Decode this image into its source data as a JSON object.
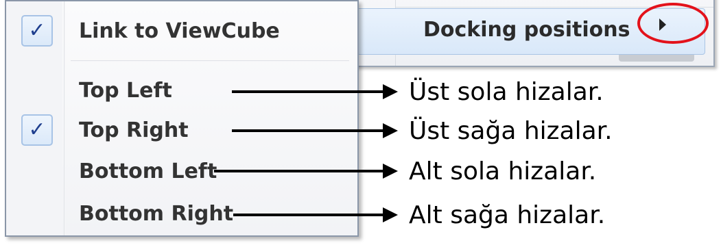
{
  "parent_menu": {
    "item_label": "Docking positions",
    "submenu_arrow_icon": "triangle-right-icon",
    "highlight_color": "#e3121b"
  },
  "submenu": {
    "items": [
      {
        "label": "Link to ViewCube",
        "checked": true
      },
      {
        "label": "Top Left",
        "checked": false
      },
      {
        "label": "Top Right",
        "checked": true
      },
      {
        "label": "Bottom Left",
        "checked": false
      },
      {
        "label": "Bottom Right",
        "checked": false
      }
    ],
    "check_glyph": "✓",
    "check_icon": "checkmark-icon"
  },
  "annotations": [
    {
      "target": "Top Left",
      "text": "Üst sola hizalar."
    },
    {
      "target": "Top Right",
      "text": "Üst sağa hizalar."
    },
    {
      "target": "Bottom Left",
      "text": "Alt sola hizalar."
    },
    {
      "target": "Bottom Right",
      "text": "Alt sağa hizalar."
    }
  ]
}
